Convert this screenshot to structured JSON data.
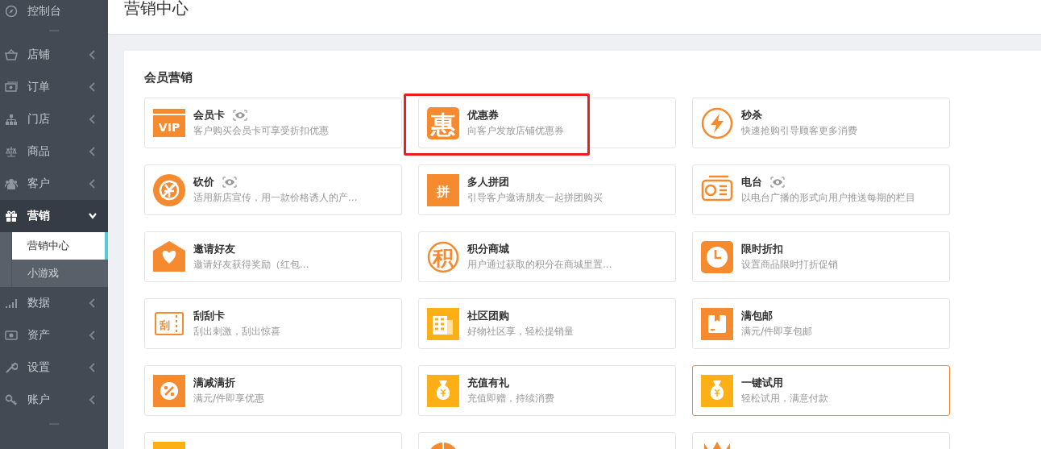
{
  "sidebar": {
    "items": [
      {
        "label": "控制台",
        "kind": "compass",
        "chevron": false,
        "selected": false
      },
      {
        "label": "店铺",
        "kind": "basket",
        "expanded": false,
        "chevron": true,
        "selected": false
      },
      {
        "label": "订单",
        "kind": "cash",
        "expanded": false,
        "chevron": true,
        "selected": false
      },
      {
        "label": "门店",
        "kind": "sitemap",
        "expanded": false,
        "chevron": true,
        "selected": false
      },
      {
        "label": "商品",
        "kind": "scale",
        "expanded": false,
        "chevron": true,
        "selected": false
      },
      {
        "label": "客户",
        "kind": "users",
        "expanded": false,
        "chevron": true,
        "selected": false
      },
      {
        "label": "营销",
        "kind": "gift",
        "expanded": true,
        "chevron": true,
        "selected": true,
        "children": [
          {
            "label": "营销中心",
            "selected": true
          },
          {
            "label": "小游戏",
            "selected": false
          }
        ]
      },
      {
        "label": "数据",
        "kind": "signal",
        "expanded": false,
        "chevron": true,
        "selected": false
      },
      {
        "label": "资产",
        "kind": "money",
        "expanded": false,
        "chevron": true,
        "selected": false
      },
      {
        "label": "设置",
        "kind": "wrench",
        "expanded": false,
        "chevron": true,
        "selected": false
      },
      {
        "label": "账户",
        "kind": "key",
        "expanded": false,
        "chevron": true,
        "selected": false
      }
    ]
  },
  "page_title": "营销中心",
  "section": {
    "title": "会员营销",
    "cards": [
      {
        "title": "会员卡",
        "desc": "客户购买会员卡可享受折扣优惠",
        "kind": "vip",
        "icon_text": "VIP",
        "preview": true,
        "highlighted": false,
        "active": false
      },
      {
        "title": "优惠券",
        "desc": "向客户发放店铺优惠券",
        "kind": "letter-rounded",
        "icon_text": "惠",
        "preview": false,
        "highlighted": true,
        "active": false
      },
      {
        "title": "秒杀",
        "desc": "快速抢购引导顾客更多消费",
        "kind": "bolt",
        "preview": false,
        "highlighted": false,
        "active": false
      },
      {
        "title": "砍价",
        "desc": "适用新店宣传，用一款价格诱人的产...",
        "kind": "bargain",
        "preview": true,
        "highlighted": false,
        "active": false
      },
      {
        "title": "多人拼团",
        "desc": "引导客户邀请朋友一起拼团购买",
        "kind": "letter-square",
        "icon_text": "拼",
        "preview": false,
        "highlighted": false,
        "active": false
      },
      {
        "title": "电台",
        "desc": "以电台广播的形式向用户推送每期的栏目",
        "kind": "radio",
        "preview": true,
        "highlighted": false,
        "active": false
      },
      {
        "title": "邀请好友",
        "desc": "邀请好友获得奖励（红包...",
        "kind": "envelope",
        "preview": false,
        "highlighted": false,
        "active": false
      },
      {
        "title": "积分商城",
        "desc": "用户通过获取的积分在商城里置...",
        "kind": "letter-circle",
        "icon_text": "积",
        "preview": false,
        "highlighted": false,
        "active": false
      },
      {
        "title": "限时折扣",
        "desc": "设置商品限时打折促销",
        "kind": "clock",
        "preview": false,
        "highlighted": false,
        "active": false
      },
      {
        "title": "刮刮卡",
        "desc": "刮出刺激，刮出惊喜",
        "kind": "ticket",
        "icon_text": "刮",
        "preview": false,
        "highlighted": false,
        "active": false
      },
      {
        "title": "社区团购",
        "desc": "好物社区享，轻松提销量",
        "kind": "building",
        "preview": false,
        "highlighted": false,
        "active": false
      },
      {
        "title": "满包邮",
        "desc": "满元/件即享包邮",
        "kind": "box",
        "preview": false,
        "highlighted": false,
        "active": false
      },
      {
        "title": "满减满折",
        "desc": "满元/件即享优惠",
        "kind": "percent",
        "preview": false,
        "highlighted": false,
        "active": false
      },
      {
        "title": "充值有礼",
        "desc": "充值即赠，持续消费",
        "kind": "moneybag",
        "preview": false,
        "highlighted": false,
        "active": false
      },
      {
        "title": "一键试用",
        "desc": "轻松试用，满意付款",
        "kind": "moneybag",
        "preview": false,
        "highlighted": false,
        "active": true
      },
      {
        "kind": "square",
        "preview": false,
        "highlighted": false,
        "active": false
      },
      {
        "kind": "ball",
        "preview": false,
        "highlighted": false,
        "active": false
      },
      {
        "kind": "crown",
        "preview": false,
        "highlighted": false,
        "active": false
      }
    ]
  }
}
